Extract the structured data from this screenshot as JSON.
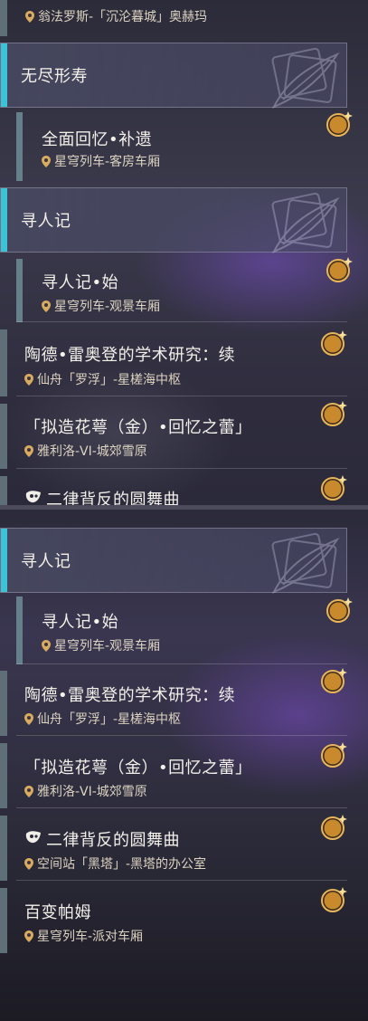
{
  "panel1": {
    "top_item": {
      "location": "翁法罗斯-「沉沦暮城」奥赫玛"
    },
    "category1": {
      "title": "无尽形寿"
    },
    "item_full_memory": {
      "title": "全面回忆•补遗",
      "location": "星穹列车-客房车厢",
      "badge": "新"
    },
    "category2": {
      "title": "寻人记"
    },
    "item_xunrenji": {
      "title": "寻人记•始",
      "location": "星穹列车-观景车厢",
      "badge": "新"
    },
    "item_taode": {
      "title": "陶德•雷奥登的学术研究：续",
      "location": "仙舟「罗浮」-星槎海中枢",
      "badge": "新"
    },
    "item_nizao": {
      "title": "「拟造花萼（金）•回忆之蕾」",
      "location": "雅利洛-VI-城郊雪原",
      "badge": "新"
    },
    "item_erlv_partial": {
      "title": "二律背反的圆舞曲",
      "badge": "新"
    }
  },
  "panel2": {
    "category": {
      "title": "寻人记"
    },
    "item_xunrenji": {
      "title": "寻人记•始",
      "location": "星穹列车-观景车厢",
      "badge": "新"
    },
    "item_taode": {
      "title": "陶德•雷奥登的学术研究：续",
      "location": "仙舟「罗浮」-星槎海中枢",
      "badge": "新"
    },
    "item_nizao": {
      "title": "「拟造花萼（金）•回忆之蕾」",
      "location": "雅利洛-VI-城郊雪原",
      "badge": "新"
    },
    "item_erlv": {
      "title": "二律背反的圆舞曲",
      "location": "空间站「黑塔」-黑塔的办公室",
      "badge": "新"
    },
    "item_baibian": {
      "title": "百变帕姆",
      "location": "星穹列车-派对车厢",
      "badge": "新"
    }
  },
  "colors": {
    "accent": "#3bc4d6",
    "badge_gold": "#e0a43a",
    "location_text": "#dcd3c0"
  },
  "icons": [
    "location-pin-icon",
    "new-badge-icon",
    "mask-icon",
    "quill-emblem-icon"
  ]
}
